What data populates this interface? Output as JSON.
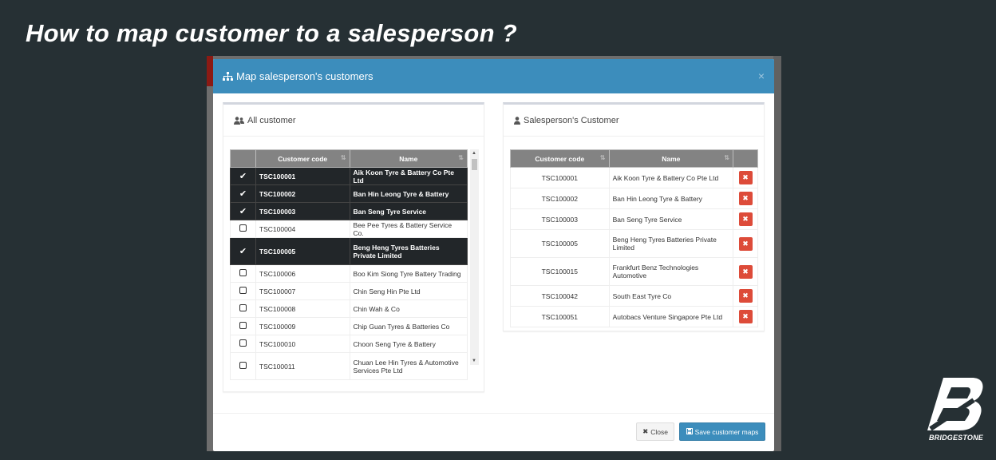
{
  "slide_title": "How to map customer to a salesperson ?",
  "modal": {
    "title": "Map salesperson's customers",
    "close_glyph": "×"
  },
  "left_panel": {
    "title": "All customer",
    "columns": [
      "Customer code",
      "Name"
    ],
    "rows": [
      {
        "selected": true,
        "code": "TSC100001",
        "name": "Aik Koon Tyre & Battery Co Pte Ltd"
      },
      {
        "selected": true,
        "code": "TSC100002",
        "name": "Ban Hin Leong Tyre & Battery"
      },
      {
        "selected": true,
        "code": "TSC100003",
        "name": "Ban Seng Tyre Service"
      },
      {
        "selected": false,
        "code": "TSC100004",
        "name": "Bee Pee Tyres & Battery Service Co."
      },
      {
        "selected": true,
        "code": "TSC100005",
        "name": "Beng Heng Tyres Batteries Private Limited"
      },
      {
        "selected": false,
        "code": "TSC100006",
        "name": "Boo Kim Siong Tyre Battery Trading"
      },
      {
        "selected": false,
        "code": "TSC100007",
        "name": "Chin Seng Hin Pte Ltd"
      },
      {
        "selected": false,
        "code": "TSC100008",
        "name": "Chin Wah & Co"
      },
      {
        "selected": false,
        "code": "TSC100009",
        "name": "Chip Guan Tyres & Batteries Co"
      },
      {
        "selected": false,
        "code": "TSC100010",
        "name": "Choon Seng Tyre & Battery"
      },
      {
        "selected": false,
        "code": "TSC100011",
        "name": "Chuan Lee Hin Tyres & Automotive Services Pte Ltd"
      }
    ]
  },
  "right_panel": {
    "title": "Salesperson's Customer",
    "columns": [
      "Customer code",
      "Name",
      ""
    ],
    "rows": [
      {
        "code": "TSC100001",
        "name": "Aik Koon Tyre & Battery Co Pte Ltd"
      },
      {
        "code": "TSC100002",
        "name": "Ban Hin Leong Tyre & Battery"
      },
      {
        "code": "TSC100003",
        "name": "Ban Seng Tyre Service"
      },
      {
        "code": "TSC100005",
        "name": "Beng Heng Tyres Batteries Private Limited"
      },
      {
        "code": "TSC100015",
        "name": "Frankfurt Benz Technologies Automotive"
      },
      {
        "code": "TSC100042",
        "name": "South East Tyre Co"
      },
      {
        "code": "TSC100051",
        "name": "Autobacs Venture Singapore Pte Ltd"
      }
    ]
  },
  "footer": {
    "close_label": "Close",
    "save_label": "Save customer maps"
  },
  "brand": {
    "logo_text": "BRIDGESTONE",
    "accent": "#3c8dbc",
    "danger": "#dd4b39"
  }
}
